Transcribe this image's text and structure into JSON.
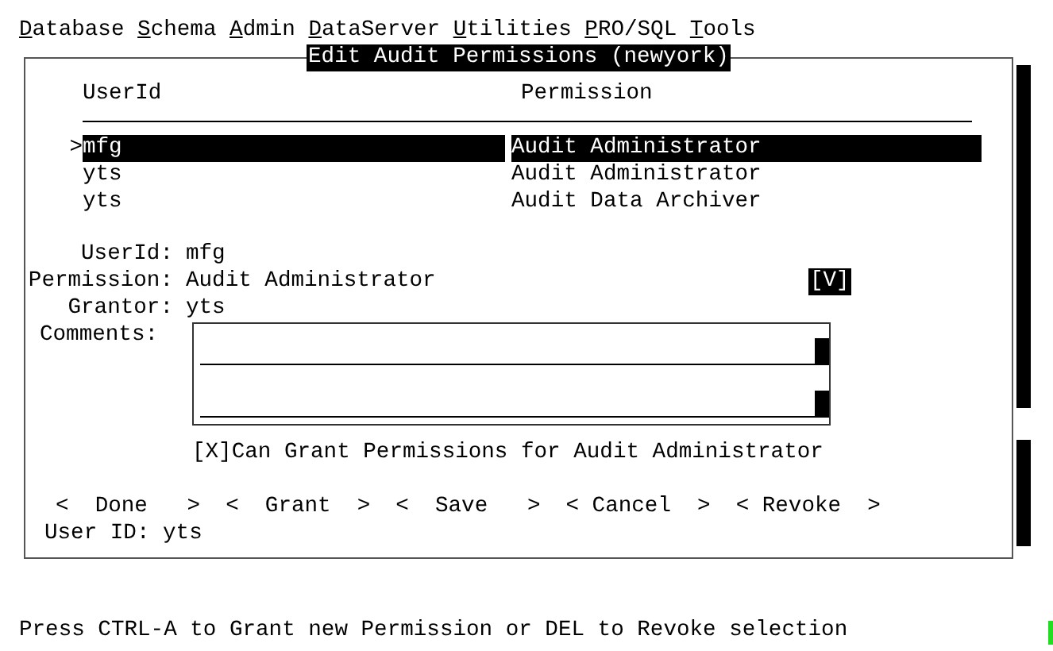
{
  "menu": [
    "Database",
    "Schema",
    "Admin",
    "DataServer",
    "Utilities",
    "PRO/SQL",
    "Tools"
  ],
  "dialog": {
    "title": "Edit Audit Permissions (newyork)",
    "table": {
      "columns": [
        "UserId",
        "Permission"
      ],
      "cursor": ">",
      "rows": [
        {
          "user": "mfg",
          "permission": "Audit Administrator",
          "selected": true
        },
        {
          "user": "yts",
          "permission": "Audit Administrator",
          "selected": false
        },
        {
          "user": "yts",
          "permission": "Audit Data Archiver",
          "selected": false
        }
      ]
    },
    "details": [
      {
        "label": "UserId:",
        "value": "mfg"
      },
      {
        "label": "Permission:",
        "value": "Audit Administrator",
        "dropdown": "[V]"
      },
      {
        "label": "Grantor:",
        "value": "yts"
      }
    ],
    "comments_label": "Comments:",
    "checkbox": {
      "box": "[X]",
      "label": "Can Grant Permissions for Audit Administrator",
      "checked": true
    },
    "buttons": [
      "<  Done   >",
      "<  Grant  >",
      "<  Save   >",
      "< Cancel  >",
      "< Revoke  >"
    ],
    "footer": "User ID: yts"
  },
  "status_bar": "Press CTRL-A to Grant new Permission or DEL to Revoke selection"
}
